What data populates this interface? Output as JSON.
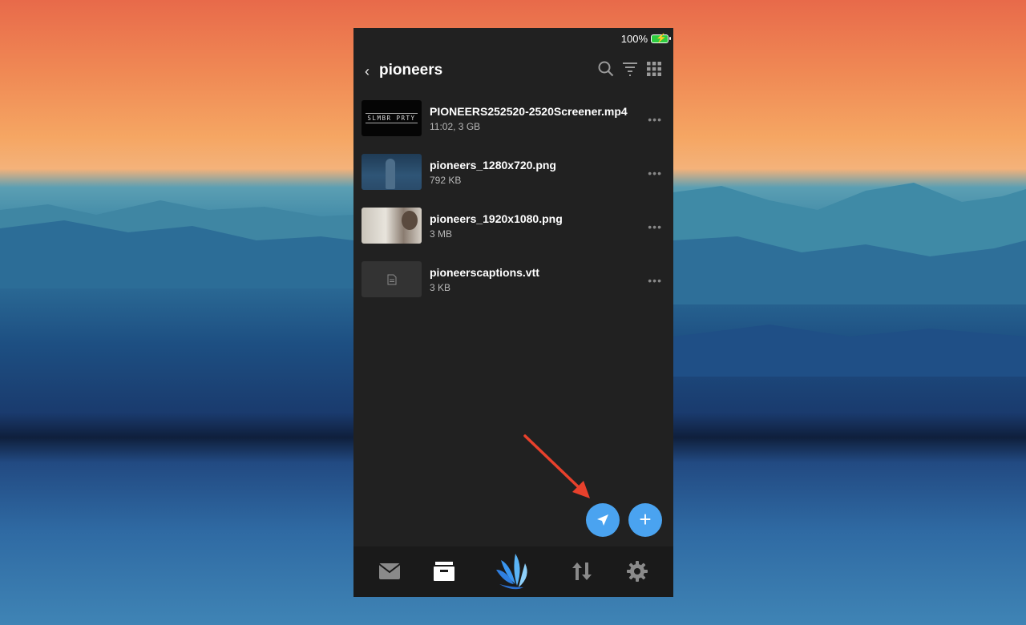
{
  "status_bar": {
    "battery_percent": "100%",
    "battery_color": "#2ecc40"
  },
  "header": {
    "back_label": "‹",
    "title": "pioneers"
  },
  "files": [
    {
      "name": "PIONEERS252520-2520Screener.mp4",
      "meta": "11:02, 3 GB",
      "thumb_text": "SLMBR PRTY",
      "thumb_type": "video"
    },
    {
      "name": "pioneers_1280x720.png",
      "meta": "792 KB",
      "thumb_type": "image-blue"
    },
    {
      "name": "pioneers_1920x1080.png",
      "meta": "3 MB",
      "thumb_type": "image-light"
    },
    {
      "name": "pioneerscaptions.vtt",
      "meta": "3 KB",
      "thumb_type": "document"
    }
  ],
  "more_label": "•••",
  "fab": {
    "accent_color": "#4aa3f0",
    "plus_label": "+"
  },
  "tabs": [
    "mail-icon",
    "archive-icon",
    "app-logo",
    "transfers-icon",
    "settings-icon"
  ],
  "annotation_color": "#e8412c"
}
